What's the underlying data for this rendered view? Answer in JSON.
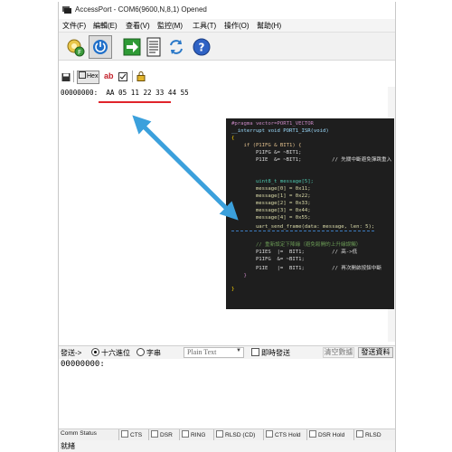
{
  "titlebar": {
    "title": "AccessPort - COM6(9600,N,8,1) Opened"
  },
  "menubar": {
    "items": [
      "文件(F)",
      "編輯(E)",
      "查看(V)",
      "監控(M)",
      "工具(T)",
      "操作(O)",
      "幫助(H)"
    ]
  },
  "toolbar": {
    "buttons": [
      "connect-settings",
      "power",
      "send-arrow",
      "document",
      "refresh",
      "help"
    ]
  },
  "subtoolbar": {
    "hex_label": "Hex",
    "ab_label": "ab"
  },
  "dataview": {
    "address": "00000000:",
    "bytes": "AA 05 11 22 33 44 55"
  },
  "code": {
    "lines": [
      "#pragma vector=PORT1_VECTOR",
      "__interrupt void PORT1_ISR(void)",
      "{",
      "    if (P1IFG & BIT1) {",
      "        P1IFG &= ~BIT1;",
      "        P1IE  &= ~BIT1;          // 先關中斷避免彈跳重入",
      "",
      "        uint8_t message[5];",
      "        message[0] = 0x11;",
      "        message[1] = 0x22;",
      "        message[2] = 0x33;",
      "        message[3] = 0x44;",
      "        message[4] = 0x55;",
      "        uart_send_frame(data: message, len: 5);",
      "",
      "        // 重新設定下降緣（避免鬆開的上升緣誤觸）",
      "        P1IES  |=  BIT1;         // 高->低",
      "        P1IFG  &= ~BIT1;",
      "        P1IE   |=  BIT1;         // 再次開啟按鈕中斷",
      "    }",
      "}"
    ]
  },
  "sendbar": {
    "send_label": "發送->",
    "hex_option": "十六進位",
    "char_option": "字串",
    "format_value": "Plain Text",
    "instant_send": "即時發送",
    "clear_label": "清空數據",
    "send_button": "發送資料"
  },
  "sendarea": {
    "address": "00000000:"
  },
  "statusrow": {
    "comm_status": "Comm Status",
    "signals": [
      "CTS",
      "DSR",
      "RING",
      "RLSD (CD)",
      "CTS Hold",
      "DSR Hold",
      "RLSD"
    ]
  },
  "bottombar": {
    "status_text": "就緒"
  },
  "colors": {
    "accent_blue": "#3ba0dc",
    "underline_red": "#e0242b",
    "code_bg": "#1e1e1e"
  }
}
